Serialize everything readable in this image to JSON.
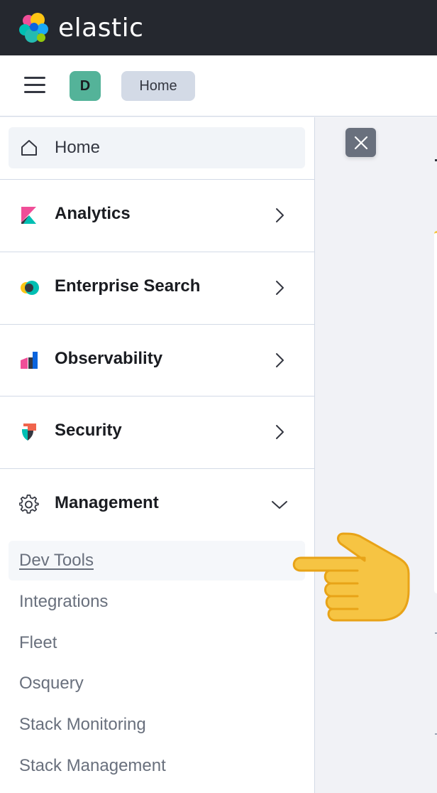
{
  "topbar": {
    "brand": "elastic"
  },
  "header": {
    "avatar_initial": "D",
    "breadcrumb": "Home"
  },
  "nav": {
    "home_label": "Home",
    "groups": [
      {
        "label": "Analytics",
        "icon": "kibana-icon",
        "expanded": false
      },
      {
        "label": "Enterprise Search",
        "icon": "enterprise-search-icon",
        "expanded": false
      },
      {
        "label": "Observability",
        "icon": "observability-icon",
        "expanded": false
      },
      {
        "label": "Security",
        "icon": "security-icon",
        "expanded": false
      },
      {
        "label": "Management",
        "icon": "gear-icon",
        "expanded": true
      }
    ],
    "management_items": [
      "Dev Tools",
      "Integrations",
      "Fleet",
      "Osquery",
      "Stack Monitoring",
      "Stack Management"
    ],
    "active_item": "Dev Tools"
  },
  "colors": {
    "topbar": "#25282f",
    "avatar": "#54b399",
    "accent": "#f3c742"
  },
  "overlay": {
    "pointer": "pointing-hand-icon"
  }
}
